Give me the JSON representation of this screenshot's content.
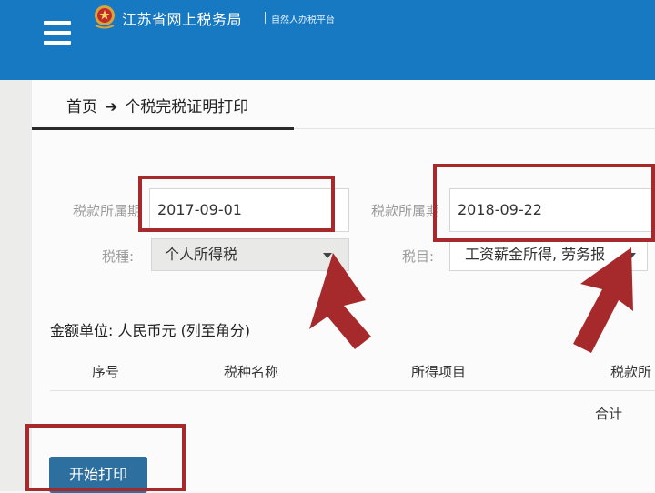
{
  "header": {
    "site_title": "江苏省网上税务局",
    "site_subtitle": "自然人办税平台",
    "menu_icon": "hamburger-menu-icon",
    "logo_icon": "tax-emblem-icon",
    "bar_color": "#1679c2"
  },
  "breadcrumb": {
    "home": "首页",
    "separator": "➔",
    "current": "个税完税证明打印"
  },
  "form": {
    "period_start_label": "税款所属期",
    "period_start_value": "2017-09-01",
    "period_end_label": "税款所属期",
    "period_end_value": "2018-09-22",
    "tax_type_label": "税種:",
    "tax_type_value": "个人所得税",
    "tax_item_label": "税目:",
    "tax_item_value": "工资薪金所得, 劳务报"
  },
  "amount_unit": "金额单位:  人民币元 (列至角分)",
  "table": {
    "columns": [
      "序号",
      "税种名称",
      "所得项目",
      "税款所"
    ],
    "total_label": "合计"
  },
  "actions": {
    "print_label": "开始打印",
    "print_color": "#2d6f9e"
  },
  "annotation_color": "#a62a2c"
}
